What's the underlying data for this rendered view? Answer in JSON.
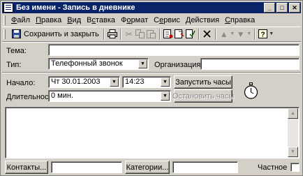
{
  "window": {
    "title": "Без имени - Запись в дневнике",
    "min_glyph": "_",
    "max_glyph": "□",
    "close_glyph": "✕"
  },
  "menu": [
    {
      "label": "Файл",
      "key": "Ф",
      "rest": "айл"
    },
    {
      "label": "Правка",
      "key": "П",
      "rest": "равка"
    },
    {
      "label": "Вид",
      "key": "В",
      "rest": "ид"
    },
    {
      "label": "Вставка",
      "key": "с",
      "pre": "В",
      "rest": "тавка"
    },
    {
      "label": "Формат",
      "key": "о",
      "pre": "Ф",
      "rest": "рмат"
    },
    {
      "label": "Сервис",
      "key": "е",
      "pre": "С",
      "rest": "рвис"
    },
    {
      "label": "Действия",
      "key": "Д",
      "rest": "ействия"
    },
    {
      "label": "Справка",
      "key": "С",
      "rest": "правка"
    }
  ],
  "toolbar": {
    "save_close_label": "Сохранить и закрыть",
    "icons": [
      "save-icon",
      "print-icon",
      "cut-icon",
      "copy-icon",
      "paste-icon",
      "insert-file-icon",
      "attach-icon",
      "delete-icon",
      "previous-icon",
      "next-icon",
      "help-icon"
    ]
  },
  "form": {
    "subject_label": "Тема:",
    "subject_value": "",
    "type_label": "Тип:",
    "type_value": "Телефонный звонок",
    "organization_label": "Организация:",
    "organization_value": "",
    "start_label": "Начало:",
    "start_date": "Чт 30.01.2003",
    "start_time": "14:23",
    "start_timer_label": "Запустить часы",
    "duration_label": "Длительность:",
    "duration_value": "0 мин.",
    "stop_timer_label": "Остановить часы",
    "notes": ""
  },
  "footer": {
    "contacts_label": "Контакты...",
    "contacts_value": "",
    "categories_label": "Категории...",
    "categories_value": "",
    "private_label": "Частное",
    "private_checked": false
  }
}
